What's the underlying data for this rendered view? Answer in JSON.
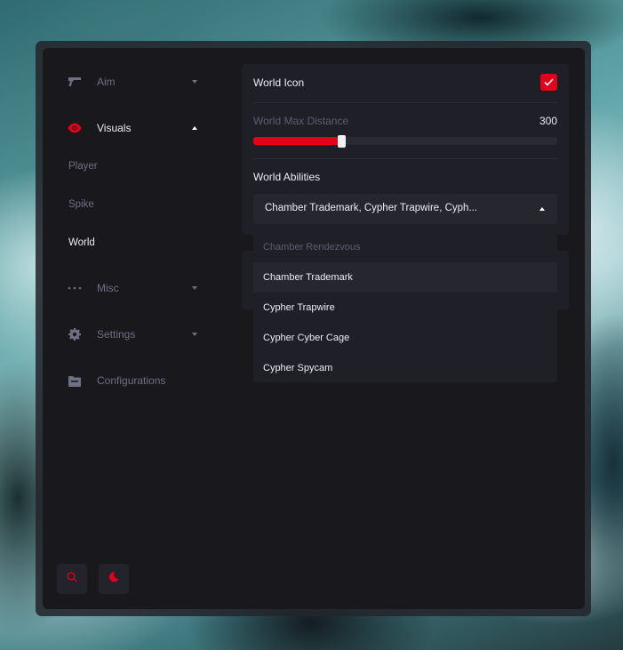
{
  "colors": {
    "accent": "#e5001a",
    "panel": "#1f1f27",
    "window": "#18181d",
    "text": "#ececf2",
    "muted": "#6f7084"
  },
  "sidebar": {
    "items": [
      {
        "label": "Aim",
        "icon": "gun-icon",
        "expanded": false
      },
      {
        "label": "Visuals",
        "icon": "eye-icon",
        "expanded": true
      },
      {
        "label": "Misc",
        "icon": "dots-icon",
        "expanded": false
      },
      {
        "label": "Settings",
        "icon": "gear-icon",
        "expanded": false
      },
      {
        "label": "Configurations",
        "icon": "folder-icon"
      }
    ],
    "sub_items": [
      {
        "label": "Player"
      },
      {
        "label": "Spike"
      },
      {
        "label": "World",
        "active": true
      }
    ],
    "bottom_buttons": [
      {
        "icon": "search-icon"
      },
      {
        "icon": "moon-icon"
      }
    ]
  },
  "world_icon": {
    "label": "World Icon",
    "checked": true
  },
  "max_distance": {
    "label": "World Max Distance",
    "value": "300",
    "fill_fraction": 0.29
  },
  "abilities": {
    "label": "World Abilities",
    "selected_text": "Chamber Trademark, Cypher Trapwire, Cyph...",
    "options": [
      {
        "label": "Chamber Rendezvous",
        "selected": false
      },
      {
        "label": "Chamber Trademark",
        "selected": true
      },
      {
        "label": "Cypher Trapwire",
        "selected": true
      },
      {
        "label": "Cypher Cyber Cage",
        "selected": true
      },
      {
        "label": "Cypher Spycam",
        "selected": true
      }
    ]
  }
}
